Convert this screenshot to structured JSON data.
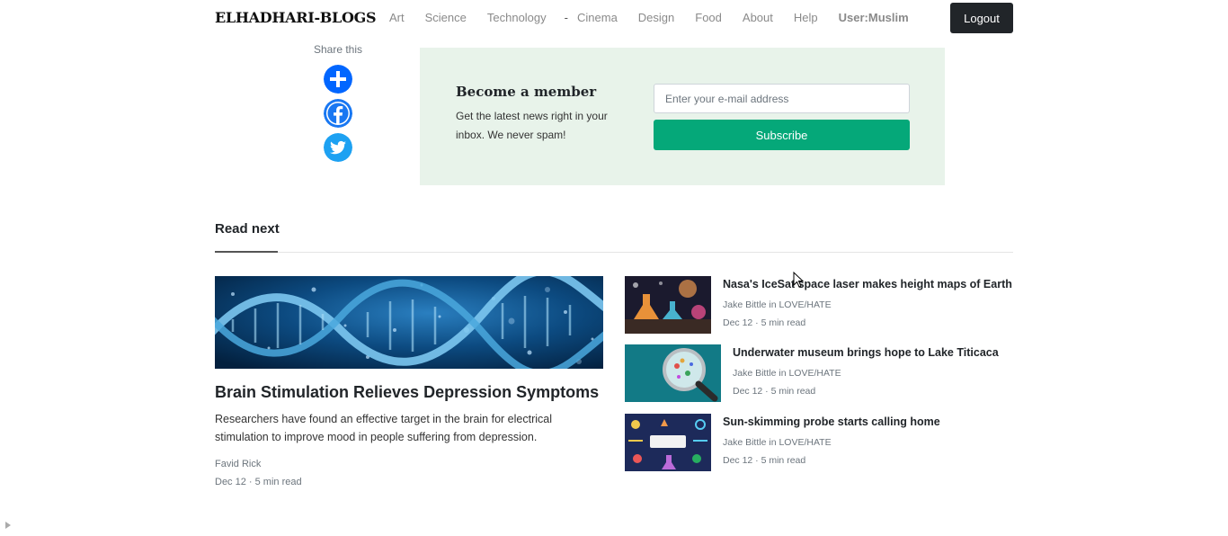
{
  "navbar": {
    "brand": "ELHADHARI-BLOGS",
    "links": [
      "Art",
      "Science",
      "Technology",
      "Cinema",
      "Design",
      "Food",
      "About",
      "Help"
    ],
    "separator": "-",
    "user": "User:Muslim",
    "logout_label": "Logout"
  },
  "share": {
    "label": "Share this",
    "buttons": [
      "plus-icon",
      "facebook-icon",
      "twitter-icon"
    ],
    "colors": {
      "addtoany": "#0166ff",
      "facebook": "#1877f2",
      "twitter": "#1da1f2"
    }
  },
  "member": {
    "title": "Become a member",
    "text": "Get the latest news right in your inbox. We never spam!",
    "email_placeholder": "Enter your e-mail address",
    "subscribe_label": "Subscribe",
    "background": "#e8f3ea",
    "button_color": "#05a879"
  },
  "read_next": {
    "heading": "Read next",
    "main": {
      "title": "Brain Stimulation Relieves Depression Symptoms",
      "description": "Researchers have found an effective target in the brain for electrical stimulation to improve mood in people suffering from depression.",
      "author": "Favid Rick",
      "meta": "Dec 12 · 5 min read",
      "image": "dna-helix-image"
    },
    "side": [
      {
        "title": "Nasa's IceSat space laser makes height maps of Earth",
        "author": "Jake Bittle in LOVE/HATE",
        "meta": "Dec 12 · 5 min read",
        "image": "lab-flasks-image"
      },
      {
        "title": "Underwater museum brings hope to Lake Titicaca",
        "author": "Jake Bittle in LOVE/HATE",
        "meta": "Dec 12 · 5 min read",
        "image": "magnifier-image"
      },
      {
        "title": "Sun-skimming probe starts calling home",
        "author": "Jake Bittle in LOVE/HATE",
        "meta": "Dec 12 · 5 min read",
        "image": "science-doodle-image"
      }
    ]
  }
}
